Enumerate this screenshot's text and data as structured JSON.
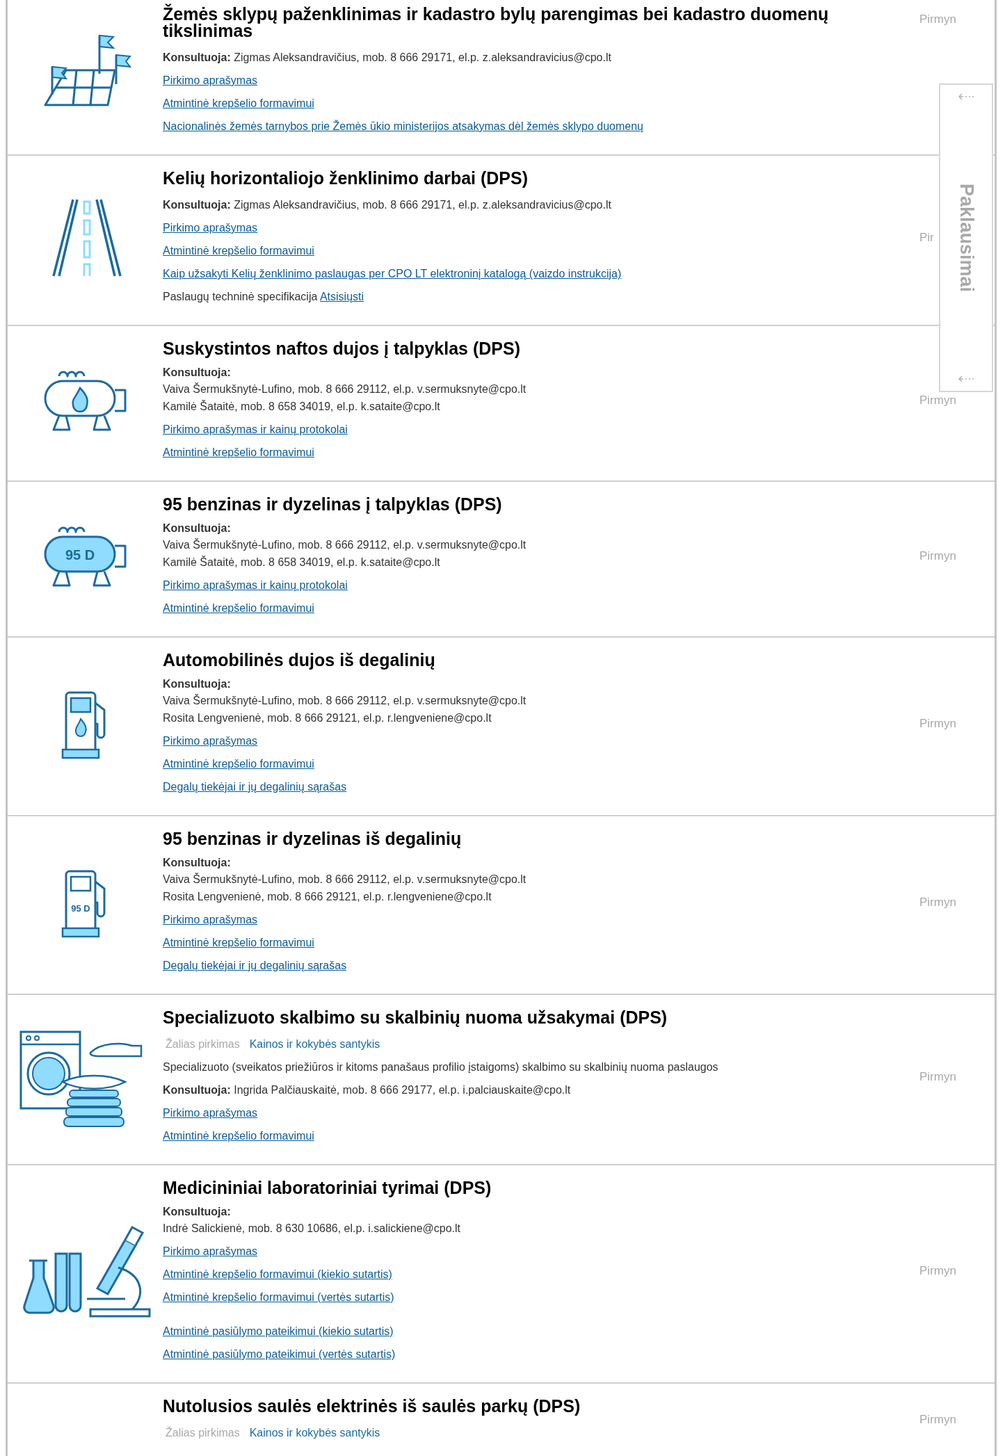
{
  "rows": [
    {
      "title": "Žemės sklypų paženklinimas ir kadastro bylų parengimas bei kadastro duomenų tikslinimas",
      "action": "Pirmyn",
      "body": [
        {
          "kind": "consult_inline",
          "label": "Konsultuoja:",
          "people": [
            "Zigmas Aleksandravičius, mob. 8 666 29171, el.p. z.aleksandravicius@cpo.lt"
          ]
        },
        {
          "kind": "link",
          "text": "Pirkimo aprašymas"
        },
        {
          "kind": "link",
          "text": "Atmintinė krepšelio formavimui"
        },
        {
          "kind": "link",
          "text": "Nacionalinės žemės tarnybos prie Žemės ūkio ministerijos atsakymas dėl žemės sklypo duomenų"
        }
      ]
    },
    {
      "title": "Kelių horizontaliojo ženklinimo darbai (DPS)",
      "action": "Pir",
      "body": [
        {
          "kind": "consult_inline",
          "label": "Konsultuoja:",
          "people": [
            "Zigmas Aleksandravičius, mob. 8 666 29171, el.p. z.aleksandravicius@cpo.lt"
          ]
        },
        {
          "kind": "link",
          "text": "Pirkimo aprašymas"
        },
        {
          "kind": "link",
          "text": "Atmintinė krepšelio formavimui"
        },
        {
          "kind": "link",
          "text": "Kaip užsakyti Kelių ženklinimo paslaugas per CPO LT elektroninį katalogą (vaizdo instrukcija)"
        },
        {
          "kind": "spec",
          "text": "Paslaugų techninė specifikacija",
          "link": "Atsisiųsti"
        }
      ]
    },
    {
      "title": "Suskystintos naftos dujos į talpyklas (DPS)",
      "action": "Pirmyn",
      "body": [
        {
          "kind": "consult_block",
          "label": "Konsultuoja:",
          "people": [
            "Vaiva Šermukšnytė-Lufino, mob. 8 666 29112, el.p. v.sermuksnyte@cpo.lt",
            "Kamilė Šataitė, mob. 8 658 34019, el.p. k.sataite@cpo.lt"
          ]
        },
        {
          "kind": "link",
          "text": "Pirkimo aprašymas ir kainų protokolai"
        },
        {
          "kind": "link",
          "text": "Atmintinė krepšelio formavimui"
        }
      ]
    },
    {
      "title": "95 benzinas ir dyzelinas į talpyklas (DPS)",
      "icon_label": "95 D",
      "action": "Pirmyn",
      "body": [
        {
          "kind": "consult_block",
          "label": "Konsultuoja:",
          "people": [
            "Vaiva Šermukšnytė-Lufino, mob. 8 666 29112, el.p. v.sermuksnyte@cpo.lt",
            "Kamilė Šataitė, mob. 8 658 34019, el.p. k.sataite@cpo.lt"
          ]
        },
        {
          "kind": "link",
          "text": "Pirkimo aprašymas ir kainų protokolai"
        },
        {
          "kind": "link",
          "text": "Atmintinė krepšelio formavimui"
        }
      ]
    },
    {
      "title": "Automobilinės dujos iš degalinių",
      "action": "Pirmyn",
      "body": [
        {
          "kind": "consult_block",
          "label": "Konsultuoja:",
          "people": [
            "Vaiva Šermukšnytė-Lufino, mob. 8 666 29112, el.p. v.sermuksnyte@cpo.lt",
            "Rosita Lengvenienė, mob. 8 666 29121, el.p. r.lengveniene@cpo.lt"
          ]
        },
        {
          "kind": "link",
          "text": "Pirkimo aprašymas"
        },
        {
          "kind": "link",
          "text": "Atmintinė krepšelio formavimui"
        },
        {
          "kind": "link",
          "text": "Degalų tiekėjai ir jų degalinių sąrašas"
        }
      ]
    },
    {
      "title": "95 benzinas ir dyzelinas iš degalinių",
      "icon_label": "95 D",
      "action": "Pirmyn",
      "body": [
        {
          "kind": "consult_block",
          "label": "Konsultuoja:",
          "people": [
            "Vaiva Šermukšnytė-Lufino, mob. 8 666 29112, el.p. v.sermuksnyte@cpo.lt",
            "Rosita Lengvenienė, mob. 8 666 29121, el.p. r.lengveniene@cpo.lt"
          ]
        },
        {
          "kind": "link",
          "text": "Pirkimo aprašymas"
        },
        {
          "kind": "link",
          "text": "Atmintinė krepšelio formavimui"
        },
        {
          "kind": "link",
          "text": "Degalų tiekėjai ir jų degalinių sąrašas"
        }
      ]
    },
    {
      "title": "Specializuoto skalbimo su skalbinių nuoma užsakymai (DPS)",
      "action": "Pirmyn",
      "body": [
        {
          "kind": "tags",
          "tags": [
            {
              "kind": "green",
              "text": "Žalias pirkimas"
            },
            {
              "kind": "quality",
              "text": "Kainos ir kokybės santykis"
            }
          ]
        },
        {
          "kind": "description",
          "text": "Specializuoto (sveikatos priežiūros ir kitoms panašaus profilio įstaigoms) skalbimo su skalbinių nuoma paslaugos"
        },
        {
          "kind": "consult_inline",
          "label": "Konsultuoja:",
          "people": [
            "Ingrida Palčiauskaitė, mob. 8 666 29177, el.p. i.palciauskaite@cpo.lt"
          ]
        },
        {
          "kind": "link",
          "text": "Pirkimo aprašymas"
        },
        {
          "kind": "link",
          "text": "Atmintinė krepšelio formavimui"
        }
      ]
    },
    {
      "title": "Medicininiai laboratoriniai tyrimai (DPS)",
      "action": "Pirmyn",
      "body": [
        {
          "kind": "consult_block",
          "label": "Konsultuoja:",
          "people": [
            "Indrė Salickienė, mob. 8 630 10686, el.p. i.salickiene@cpo.lt"
          ]
        },
        {
          "kind": "link",
          "text": "Pirkimo aprašymas"
        },
        {
          "kind": "link",
          "text": "Atmintinė krepšelio formavimui (kiekio sutartis)"
        },
        {
          "kind": "link",
          "text": "Atmintinė krepšelio formavimui (vertės sutartis)"
        },
        {
          "kind": "spacer"
        },
        {
          "kind": "link",
          "text": "Atmintinė pasiūlymo pateikimui (kiekio sutartis)"
        },
        {
          "kind": "link",
          "text": "Atmintinė pasiūlymo pateikimui (vertės sutartis)"
        }
      ]
    },
    {
      "title": "Nutolusios saulės elektrinės iš saulės parkų (DPS)",
      "action": "Pirmyn",
      "body": [
        {
          "kind": "tags",
          "tags": [
            {
              "kind": "green",
              "text": "Žalias pirkimas"
            },
            {
              "kind": "quality",
              "text": "Kainos ir kokybės santykis"
            }
          ]
        }
      ]
    }
  ],
  "side_panel": {
    "title": "Paklausimai"
  }
}
